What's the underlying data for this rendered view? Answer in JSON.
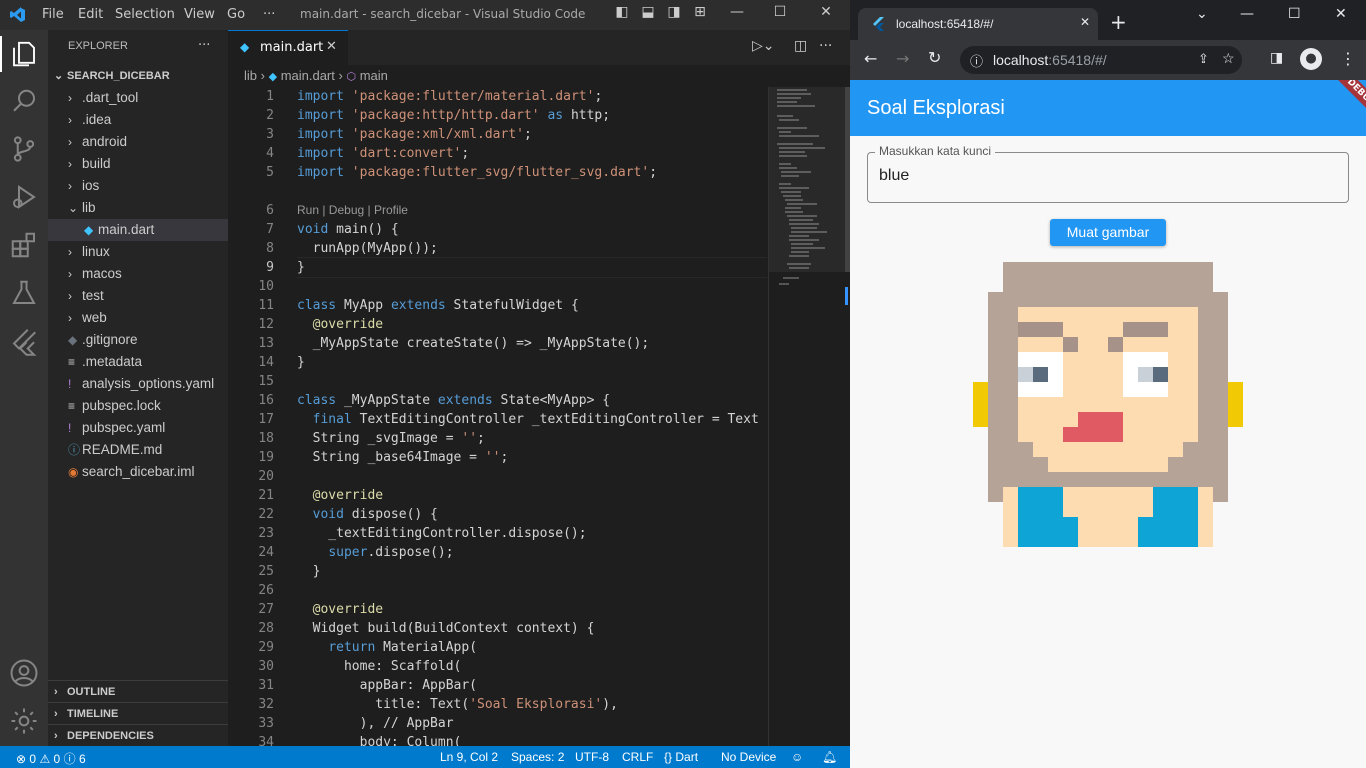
{
  "vscode": {
    "menu": [
      "File",
      "Edit",
      "Selection",
      "View",
      "Go",
      "···"
    ],
    "window_title": "main.dart - search_dicebar - Visual Studio Code",
    "explorer_title": "EXPLORER",
    "explorer_more": "···",
    "project": "SEARCH_DICEBAR",
    "tree": [
      {
        "label": ".dart_tool",
        "type": "folder"
      },
      {
        "label": ".idea",
        "type": "folder"
      },
      {
        "label": "android",
        "type": "folder"
      },
      {
        "label": "build",
        "type": "folder"
      },
      {
        "label": "ios",
        "type": "folder"
      },
      {
        "label": "lib",
        "type": "folder-open"
      },
      {
        "label": "main.dart",
        "type": "dart-file"
      },
      {
        "label": "linux",
        "type": "folder"
      },
      {
        "label": "macos",
        "type": "folder"
      },
      {
        "label": "test",
        "type": "folder"
      },
      {
        "label": "web",
        "type": "folder"
      },
      {
        "label": ".gitignore",
        "type": "git-file"
      },
      {
        "label": ".metadata",
        "type": "text-file"
      },
      {
        "label": "analysis_options.yaml",
        "type": "yaml-file"
      },
      {
        "label": "pubspec.lock",
        "type": "text-file"
      },
      {
        "label": "pubspec.yaml",
        "type": "yaml-file"
      },
      {
        "label": "README.md",
        "type": "info-file"
      },
      {
        "label": "search_dicebar.iml",
        "type": "rss-file"
      }
    ],
    "panels": [
      "OUTLINE",
      "TIMELINE",
      "DEPENDENCIES"
    ],
    "tab_label": "main.dart",
    "breadcrumb": [
      "lib",
      "main.dart",
      "main"
    ],
    "codelens": "Run | Debug | Profile",
    "line_numbers": [
      "1",
      "2",
      "3",
      "4",
      "5",
      "",
      "6",
      "7",
      "8",
      "9",
      "10",
      "11",
      "12",
      "13",
      "14",
      "15",
      "16",
      "17",
      "18",
      "19",
      "20",
      "21",
      "22",
      "23",
      "24",
      "25",
      "26",
      "27",
      "28",
      "29",
      "30",
      "31",
      "32",
      "33",
      "34"
    ],
    "code": [
      "import 'package:flutter/material.dart';",
      "import 'package:http/http.dart' as http;",
      "import 'package:xml/xml.dart';",
      "import 'dart:convert';",
      "import 'package:flutter_svg/flutter_svg.dart';",
      "",
      "Run | Debug | Profile",
      "void main() {",
      "  runApp(MyApp());",
      "}",
      "",
      "class MyApp extends StatefulWidget {",
      "  @override",
      "  _MyAppState createState() => _MyAppState();",
      "}",
      "",
      "class _MyAppState extends State<MyApp> {",
      "  final TextEditingController _textEditingController = Text",
      "  String _svgImage = '';",
      "  String _base64Image = '';",
      "",
      "  @override",
      "  void dispose() {",
      "    _textEditingController.dispose();",
      "    super.dispose();",
      "  }",
      "",
      "  @override",
      "  Widget build(BuildContext context) {",
      "    return MaterialApp(",
      "      home: Scaffold(",
      "        appBar: AppBar(",
      "          title: Text('Soal Eksplorasi'),",
      "        ), // AppBar",
      "        body: Column("
    ],
    "status": {
      "errors": "0",
      "warnings": "0",
      "info": "6",
      "position": "Ln 9, Col 2",
      "spaces": "Spaces: 2",
      "encoding": "UTF-8",
      "eol": "CRLF",
      "language": "Dart",
      "device": "No Device"
    }
  },
  "browser": {
    "tab_title": "localhost:65418/#/",
    "url_host": "localhost",
    "url_rest": ":65418/#/",
    "app_title": "Soal Eksplorasi",
    "debug_banner": "DEBUG",
    "field_label": "Masukkan kata kunci",
    "field_value": "blue",
    "button_label": "Muat gambar"
  },
  "colors": {
    "vscode_accent": "#007acc",
    "flutter_primary": "#2196f3"
  }
}
